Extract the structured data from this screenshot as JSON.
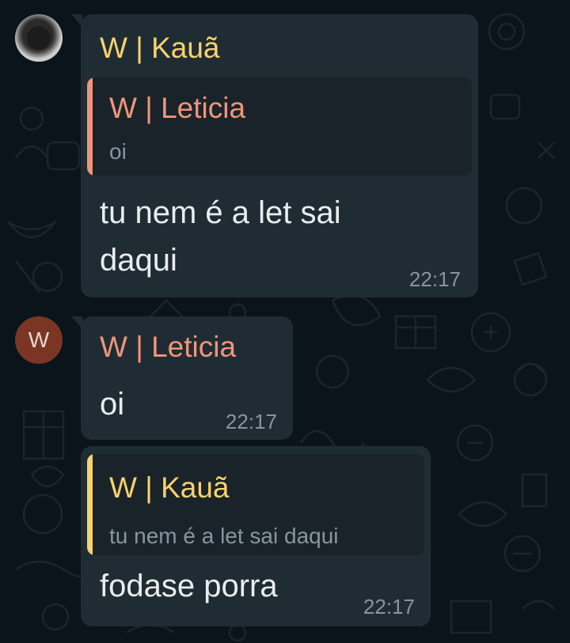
{
  "colors": {
    "background": "#0b141a",
    "bubble": "#202c33",
    "quote_background": "#1a2329",
    "sender_kaua": "#f7d26e",
    "sender_leticia": "#f0957a",
    "message_text": "#e9edef",
    "meta_text": "#8696a0"
  },
  "messages": [
    {
      "avatar": {
        "icon": "profile-photo-icon",
        "letter": ""
      },
      "sender": "W | Kauã",
      "quote": {
        "sender": "W | Leticia",
        "text": "oi"
      },
      "text_lines": [
        "tu nem é a let sai",
        "daqui"
      ],
      "time": "22:17"
    },
    {
      "avatar": {
        "icon": "letter-avatar-icon",
        "letter": "W"
      },
      "sender": "W | Leticia",
      "text_lines": [
        "oi"
      ],
      "time": "22:17"
    },
    {
      "quote": {
        "sender": "W | Kauã",
        "text": "tu nem é a let sai daqui"
      },
      "text_lines": [
        "fodase porra"
      ],
      "time": "22:17"
    }
  ]
}
